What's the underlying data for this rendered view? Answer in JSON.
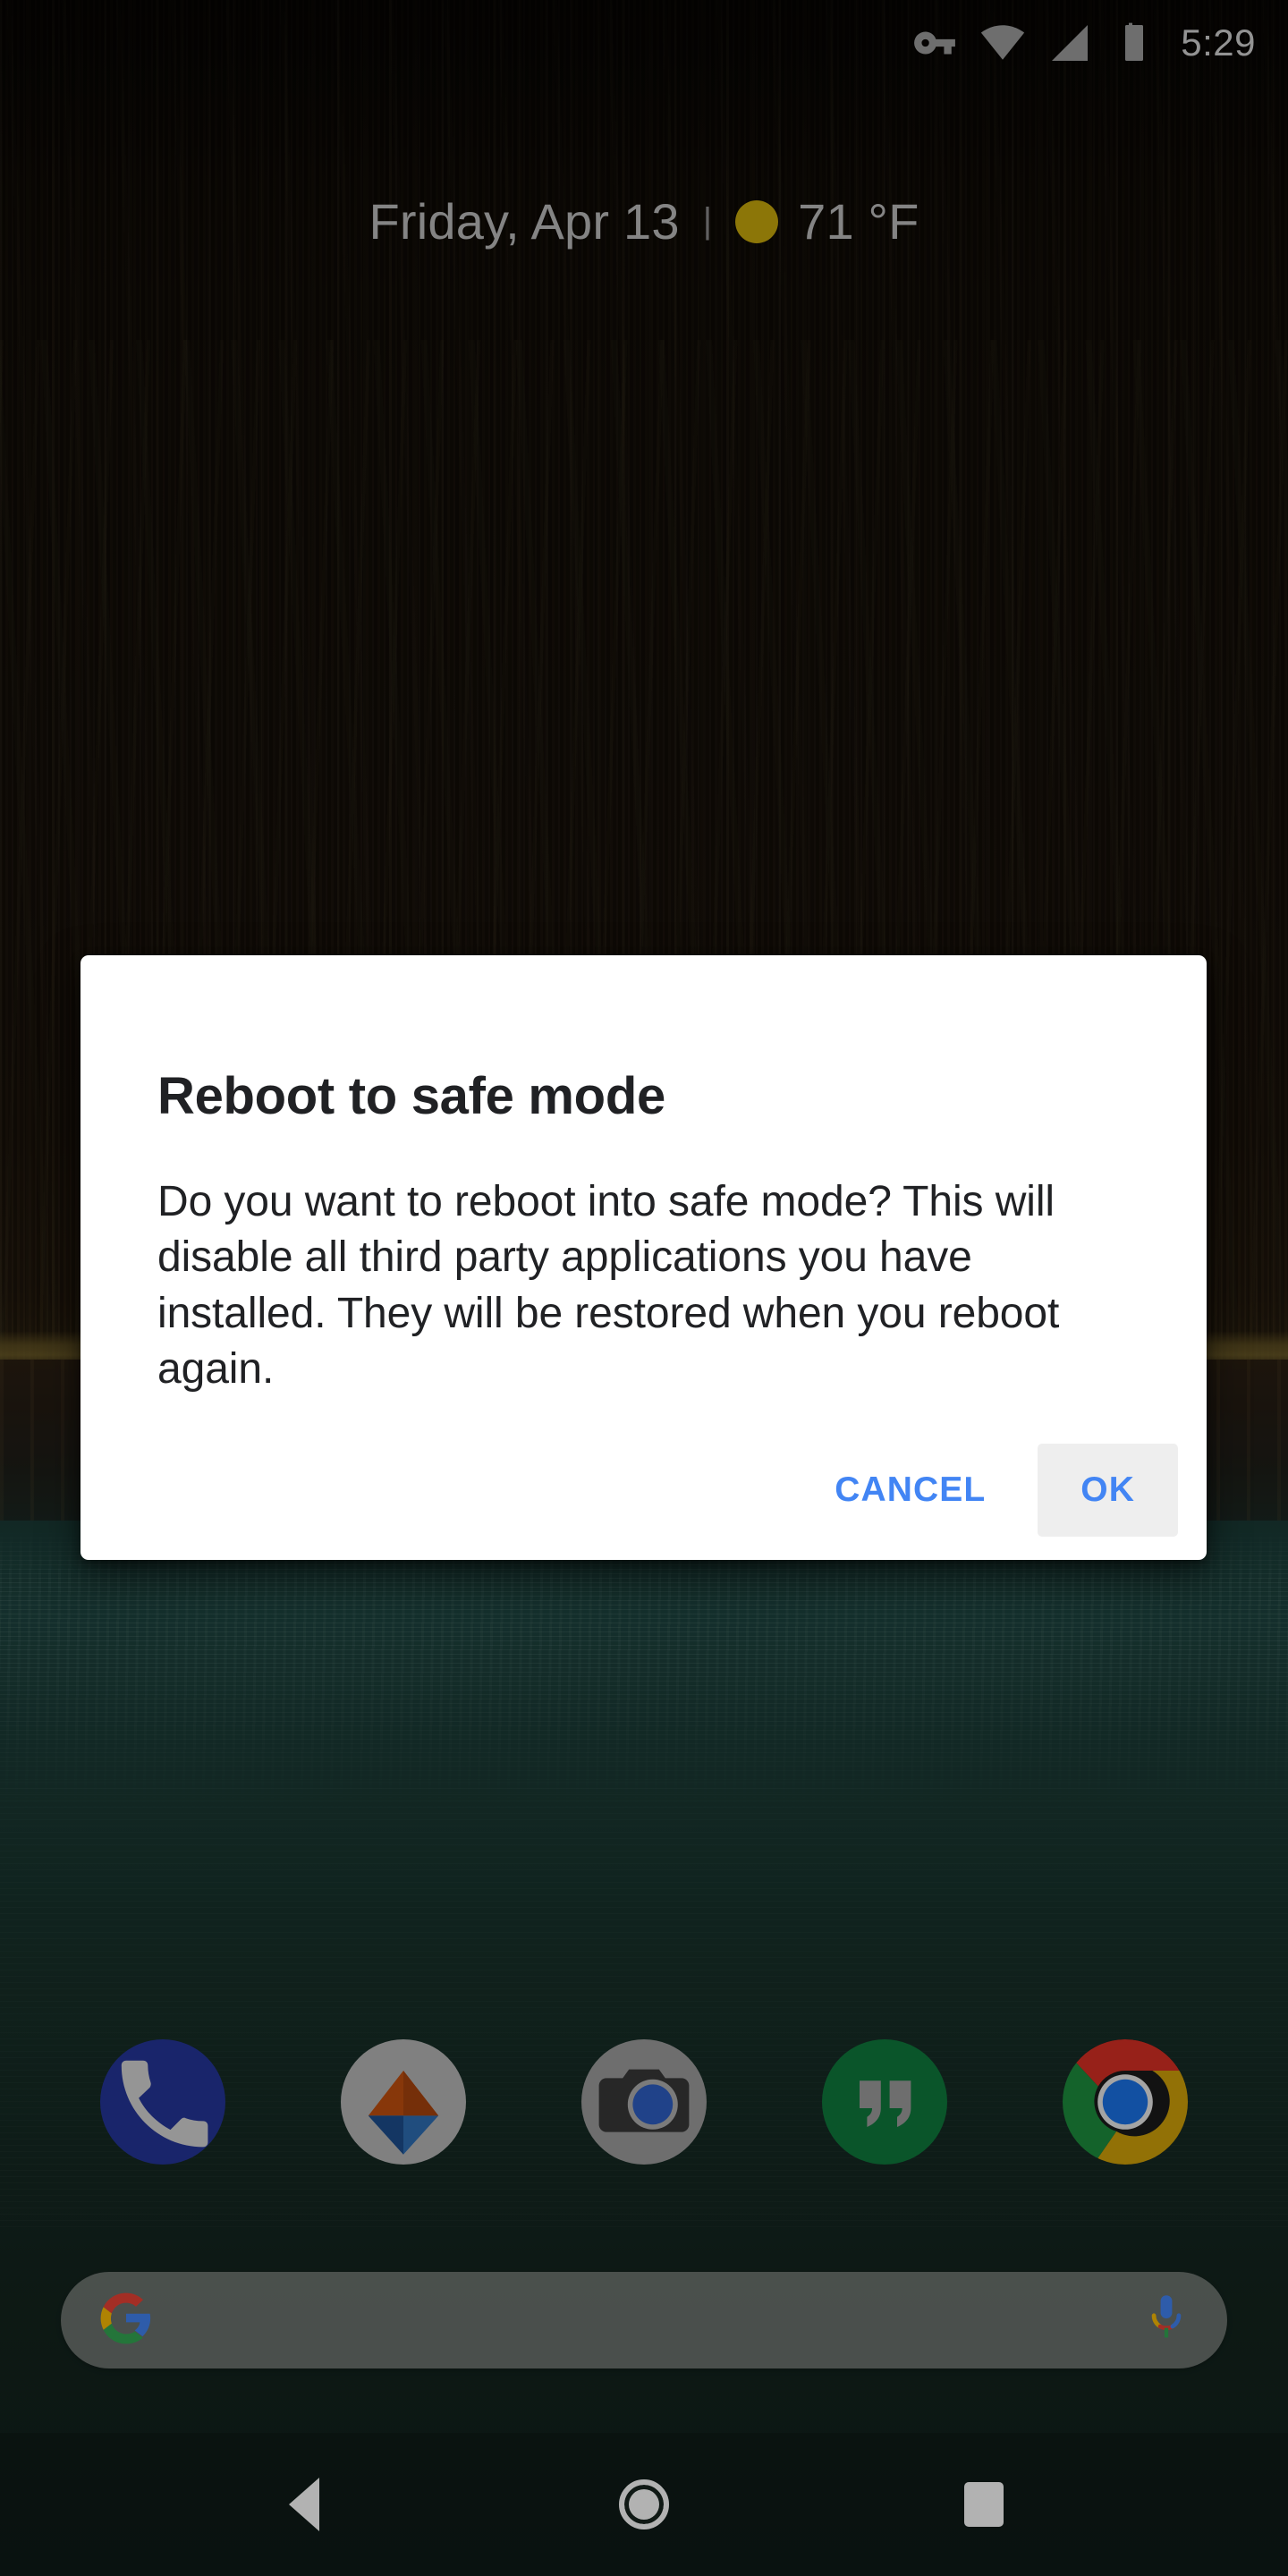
{
  "status_bar": {
    "icons": [
      {
        "name": "vpn-key-icon",
        "label": "VPN"
      },
      {
        "name": "wifi-icon",
        "label": "Wi-Fi"
      },
      {
        "name": "cellular-signal-icon",
        "label": "Mobile signal"
      },
      {
        "name": "battery-icon",
        "label": "Battery"
      }
    ],
    "time": "5:29",
    "icon_color": "#9e9e9e",
    "text_color": "#d3d3d3"
  },
  "date_widget": {
    "date": "Friday, Apr 13",
    "separator": "|",
    "weather_icon": "sunny-icon",
    "weather_icon_color": "#c9a90c",
    "temperature": "71 °F"
  },
  "dialog": {
    "title": "Reboot to safe mode",
    "message": "Do you want to reboot into safe mode? This will disable all third party applications you have installed. They will be restored when you reboot again.",
    "cancel_label": "CANCEL",
    "ok_label": "OK",
    "accent_color": "#4285f4",
    "surface_color": "#ffffff",
    "ok_highlight_color": "#eeeeee"
  },
  "dock": {
    "apps": [
      {
        "name": "phone-app-icon",
        "label": "Phone",
        "color": "#25369a"
      },
      {
        "name": "files-app-icon",
        "label": "Files",
        "color": "#b8b8b8"
      },
      {
        "name": "camera-app-icon",
        "label": "Camera",
        "color": "#9e9e9e"
      },
      {
        "name": "hangouts-app-icon",
        "label": "Hangouts",
        "color": "#0f7a3d"
      },
      {
        "name": "chrome-app-icon",
        "label": "Chrome",
        "color": "#1b1b1b"
      }
    ]
  },
  "search_bar": {
    "logo": "google-g-icon",
    "query": "",
    "placeholder": "",
    "mic_icon": "microphone-icon"
  },
  "nav_bar": {
    "back_label": "Back",
    "home_label": "Home",
    "recents_label": "Recent apps"
  },
  "wallpaper": {
    "description": "Dark forest above a teal alpine lake",
    "forest_color": "#16100a",
    "water_color": "#14251f"
  }
}
